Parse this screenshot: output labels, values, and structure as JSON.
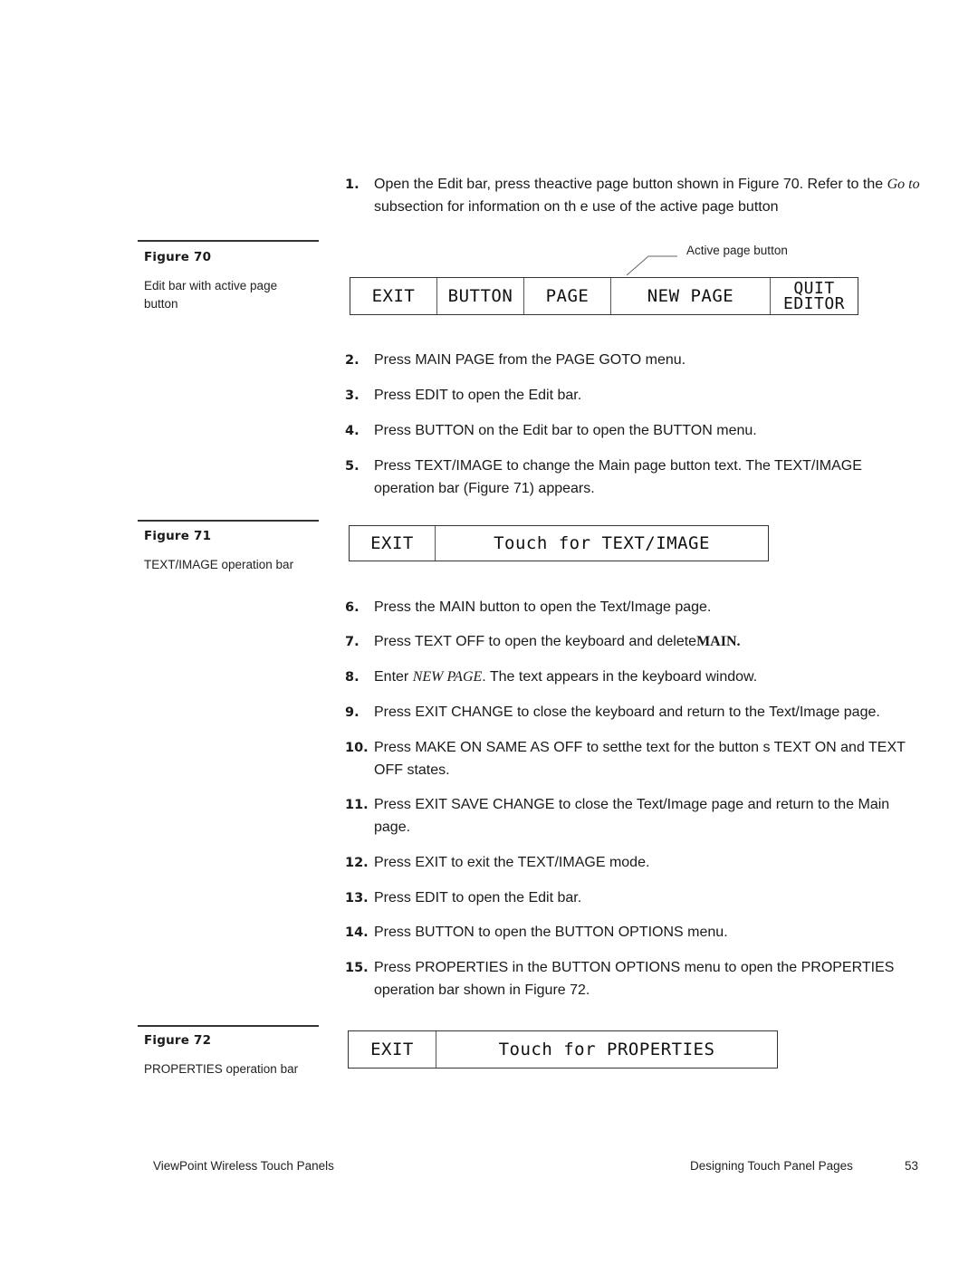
{
  "figures": [
    {
      "label": "Figure 70",
      "caption": "Edit bar with active page button"
    },
    {
      "label": "Figure 71",
      "caption": "TEXT/IMAGE operation bar"
    },
    {
      "label": "Figure 72",
      "caption": "PROPERTIES operation bar"
    }
  ],
  "figure70": {
    "callout": "Active page button",
    "buttons": [
      {
        "label": "EXIT"
      },
      {
        "label": "BUTTON"
      },
      {
        "label": "PAGE"
      },
      {
        "label": "NEW PAGE"
      },
      {
        "label_line1": "QUIT",
        "label_line2": "EDITOR"
      }
    ]
  },
  "figure71": {
    "exit": "EXIT",
    "touch": "Touch for TEXT/IMAGE"
  },
  "figure72": {
    "exit": "EXIT",
    "touch": "Touch for PROPERTIES"
  },
  "steps": [
    {
      "num": "1.",
      "a": "Open the Edit bar, press theactive page button shown in  Figure 70. Refer to the ",
      "it": "Go to",
      "b": " subsection for information on th e use of the active page button"
    },
    {
      "num": "2.",
      "text": "Press MAIN PAGE from the PAGE GOTO menu."
    },
    {
      "num": "3.",
      "text": "Press EDIT to open the Edit bar."
    },
    {
      "num": "4.",
      "text": "Press BUTTON on the Edit bar to open the BUTTON menu."
    },
    {
      "num": "5.",
      "text": "Press TEXT/IMAGE to change the Main  page button text. The TEXT/IMAGE operation bar (Figure 71) appears."
    },
    {
      "num": "6.",
      "text": "Press the MAIN button to open the Text/Image page."
    },
    {
      "num": "7.",
      "a": "Press TEXT OFF to open the keyboard and delete",
      "bold": "MAIN."
    },
    {
      "num": "8.",
      "a": "Enter ",
      "it": "NEW PAGE",
      "b": ".  The text appears in the keyboard window."
    },
    {
      "num": "9.",
      "text": "Press EXIT CHANGE to close the keyboard and return to the Text/Image page."
    },
    {
      "num": "10.",
      "text": "Press MAKE ON SAME AS OFF to setthe text for the button s TEXT ON and TEXT OFF states."
    },
    {
      "num": "11.",
      "text": "Press EXIT SAVE CHANGE to close the Text/Image page and return to the Main page."
    },
    {
      "num": "12.",
      "text": "Press EXIT to exit the TEXT/IMAGE mode."
    },
    {
      "num": "13.",
      "text": "Press EDIT to open the Edit bar."
    },
    {
      "num": "14.",
      "text": "Press BUTTON to open the BUTTON OPTIONS menu."
    },
    {
      "num": "15.",
      "text": "Press PROPERTIES in the BUTTON OPTIONS menu to open the PROPERTIES operation bar shown in  Figure 72."
    }
  ],
  "footer": {
    "left": "ViewPoint Wireless Touch Panels",
    "section": "Designing Touch Panel Pages",
    "page": "53"
  }
}
